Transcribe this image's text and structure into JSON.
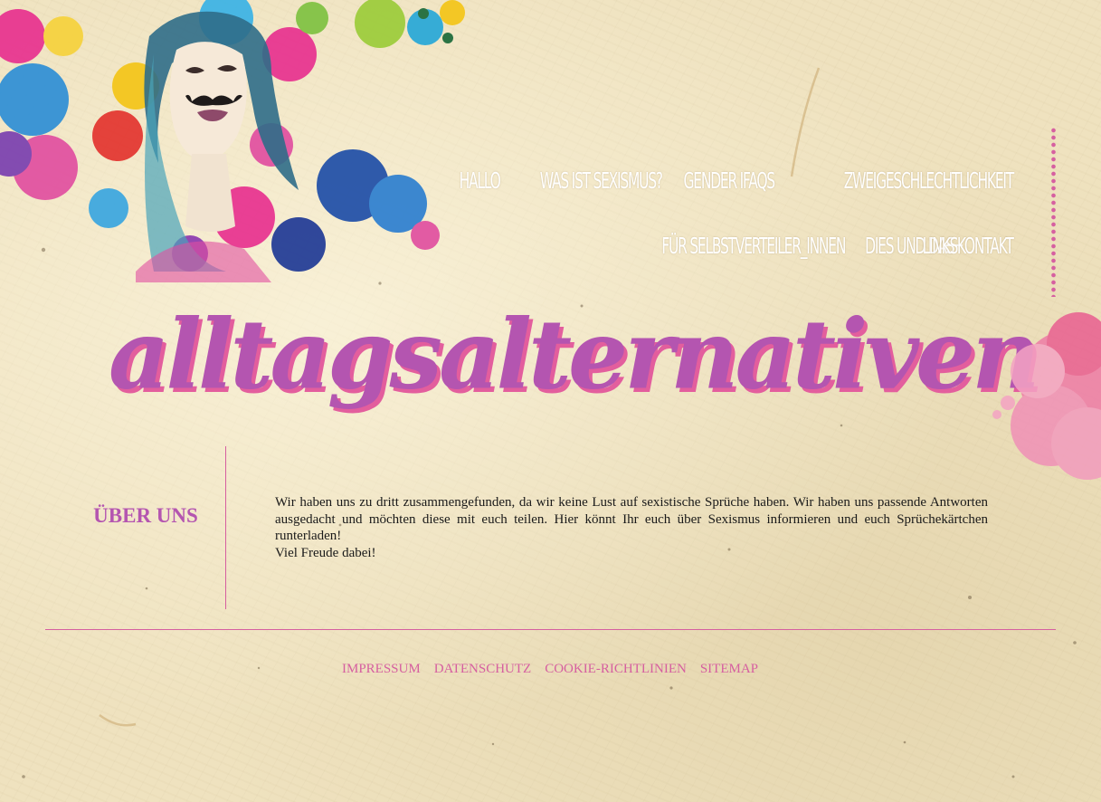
{
  "nav": {
    "row1": [
      "Hallo",
      "Was ist Sexismus?",
      "Gender IFAQs",
      "Zweigeschlechtlichkeit"
    ],
    "row2": [
      "Für Selbstverteiler_innen",
      "Dies und Das",
      "Links",
      "Kontakt"
    ]
  },
  "site": {
    "title": "alltagsalternativen"
  },
  "about": {
    "heading": "Über uns",
    "paragraph1": "Wir haben uns zu dritt zusammengefunden, da wir keine Lust auf sexistische Sprüche haben. Wir haben uns passende Antworten ausgedacht und möchten diese mit euch teilen. Hier könnt Ihr euch über Sexismus informieren und euch Sprüchekärtchen runterladen!",
    "paragraph2": "Viel Freude dabei!"
  },
  "footer": {
    "links": [
      "Impressum",
      "Datenschutz",
      "Cookie-Richtlinien",
      "Sitemap"
    ]
  },
  "colors": {
    "accent_purple": "#b455b0",
    "accent_pink": "#d65fa0",
    "paper": "#efe2bf"
  }
}
